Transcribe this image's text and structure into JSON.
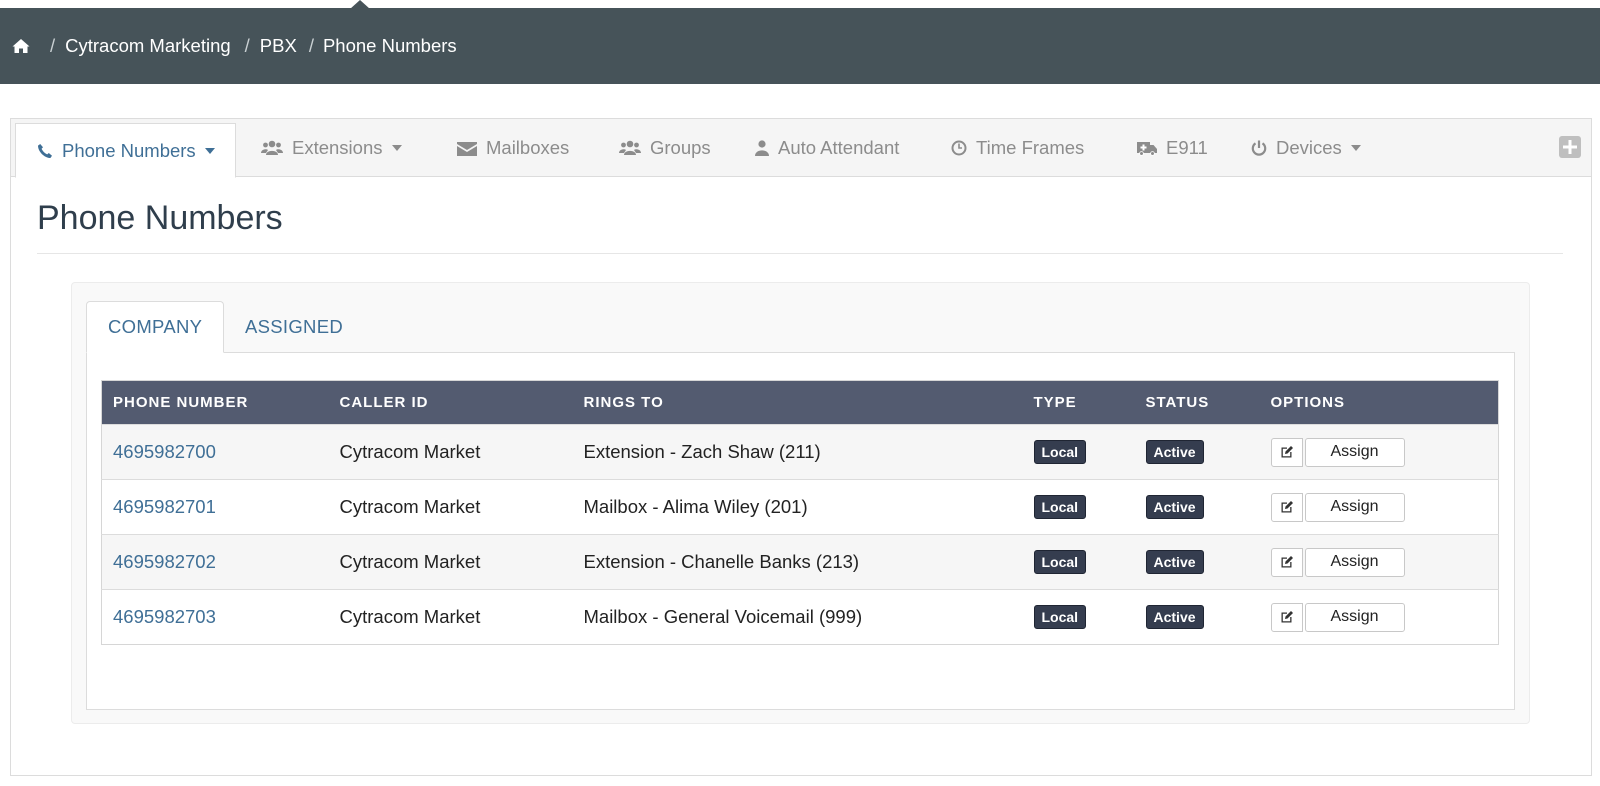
{
  "breadcrumb": {
    "items": [
      "Cytracom Marketing",
      "PBX",
      "Phone Numbers"
    ]
  },
  "tabs": [
    {
      "label": "Phone Numbers",
      "icon": "phone-icon",
      "dropdown": true,
      "active": true
    },
    {
      "label": "Extensions",
      "icon": "users-icon",
      "dropdown": true
    },
    {
      "label": "Mailboxes",
      "icon": "envelope-icon",
      "dropdown": false
    },
    {
      "label": "Groups",
      "icon": "users-icon",
      "dropdown": false
    },
    {
      "label": "Auto Attendant",
      "icon": "user-icon",
      "dropdown": false
    },
    {
      "label": "Time Frames",
      "icon": "clock-icon",
      "dropdown": false
    },
    {
      "label": "E911",
      "icon": "ambulance-icon",
      "dropdown": false
    },
    {
      "label": "Devices",
      "icon": "power-icon",
      "dropdown": true
    }
  ],
  "page": {
    "title": "Phone Numbers"
  },
  "subtabs": [
    "COMPANY",
    "ASSIGNED"
  ],
  "table": {
    "headers": [
      "PHONE NUMBER",
      "CALLER ID",
      "RINGS TO",
      "TYPE",
      "STATUS",
      "OPTIONS"
    ],
    "rows": [
      {
        "number": "4695982700",
        "caller_id": "Cytracom Market",
        "rings_to": "Extension - Zach Shaw (211)",
        "type": "Local",
        "status": "Active",
        "assign": "Assign"
      },
      {
        "number": "4695982701",
        "caller_id": "Cytracom Market",
        "rings_to": "Mailbox - Alima Wiley (201)",
        "type": "Local",
        "status": "Active",
        "assign": "Assign"
      },
      {
        "number": "4695982702",
        "caller_id": "Cytracom Market",
        "rings_to": "Extension - Chanelle Banks (213)",
        "type": "Local",
        "status": "Active",
        "assign": "Assign"
      },
      {
        "number": "4695982703",
        "caller_id": "Cytracom Market",
        "rings_to": "Mailbox - General Voicemail (999)",
        "type": "Local",
        "status": "Active",
        "assign": "Assign"
      }
    ]
  },
  "colors": {
    "header_bg": "#465359",
    "table_header_bg": "#535b70",
    "link": "#3f6f96",
    "badge_bg": "#353d4f"
  }
}
